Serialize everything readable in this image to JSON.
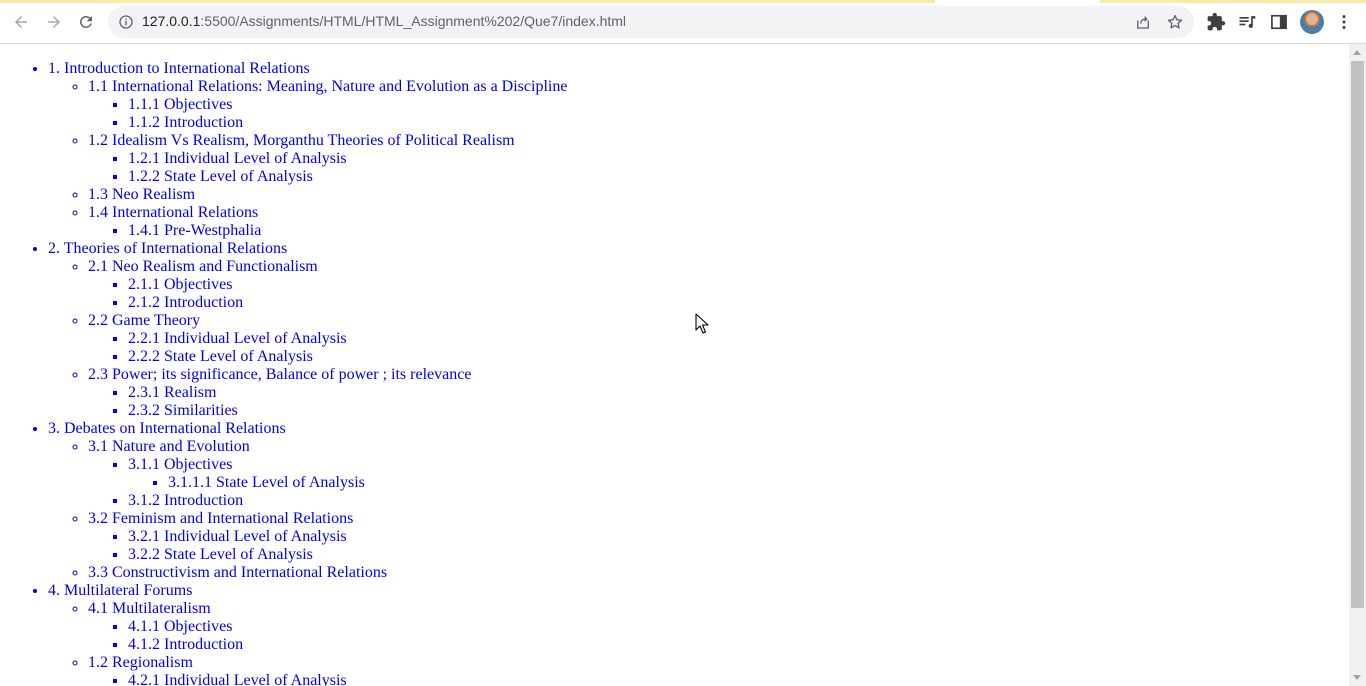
{
  "browser": {
    "url_host": "127.0.0.1",
    "url_path": ":5500/Assignments/HTML/HTML_Assignment%202/Que7/index.html",
    "icons": {
      "back": "arrow-left-icon",
      "forward": "arrow-right-icon",
      "reload": "reload-icon",
      "site_info": "info-icon",
      "share": "share-icon",
      "bookmark": "star-icon",
      "extensions": "puzzle-icon",
      "media": "media-queue-icon",
      "side_panel": "side-panel-icon",
      "profile": "avatar",
      "menu": "kebab-menu-icon"
    }
  },
  "toc": [
    {
      "label": "1. Introduction to International Relations",
      "children": [
        {
          "label": "1.1 International Relations: Meaning, Nature and Evolution as a Discipline",
          "children": [
            {
              "label": "1.1.1 Objectives"
            },
            {
              "label": "1.1.2 Introduction"
            }
          ]
        },
        {
          "label": "1.2 Idealism Vs Realism, Morganthu Theories of Political Realism",
          "children": [
            {
              "label": "1.2.1 Individual Level of Analysis"
            },
            {
              "label": "1.2.2 State Level of Analysis"
            }
          ]
        },
        {
          "label": "1.3 Neo Realism",
          "children": []
        },
        {
          "label": "1.4 International Relations",
          "children": [
            {
              "label": "1.4.1 Pre-Westphalia"
            }
          ]
        }
      ]
    },
    {
      "label": "2. Theories of International Relations",
      "children": [
        {
          "label": "2.1 Neo Realism and Functionalism",
          "children": [
            {
              "label": "2.1.1 Objectives"
            },
            {
              "label": "2.1.2 Introduction"
            }
          ]
        },
        {
          "label": "2.2 Game Theory",
          "children": [
            {
              "label": "2.2.1 Individual Level of Analysis"
            },
            {
              "label": "2.2.2 State Level of Analysis"
            }
          ]
        },
        {
          "label": "2.3 Power; its significance, Balance of power ; its relevance",
          "children": [
            {
              "label": "2.3.1 Realism"
            },
            {
              "label": "2.3.2 Similarities"
            }
          ]
        }
      ]
    },
    {
      "label": "3. Debates on International Relations",
      "children": [
        {
          "label": "3.1 Nature and Evolution",
          "children": [
            {
              "label": "3.1.1 Objectives",
              "children": [
                {
                  "label": "3.1.1.1 State Level of Analysis"
                }
              ]
            },
            {
              "label": "3.1.2 Introduction"
            }
          ]
        },
        {
          "label": "3.2 Feminism and International Relations",
          "children": [
            {
              "label": "3.2.1 Individual Level of Analysis"
            },
            {
              "label": "3.2.2 State Level of Analysis"
            }
          ]
        },
        {
          "label": "3.3 Constructivism and International Relations",
          "children": []
        }
      ]
    },
    {
      "label": "4. Multilateral Forums",
      "children": [
        {
          "label": "4.1 Multilateralism",
          "children": [
            {
              "label": "4.1.1 Objectives"
            },
            {
              "label": "4.1.2 Introduction"
            }
          ]
        },
        {
          "label": "1.2 Regionalism",
          "children": [
            {
              "label": "4.2.1 Individual Level of Analysis"
            }
          ]
        }
      ]
    }
  ],
  "colors": {
    "link": "#0000ee",
    "chrome_bg": "#ffffff",
    "omnibox_bg": "#f1f3f4",
    "scrollbar_thumb": "#c1c1c1"
  }
}
